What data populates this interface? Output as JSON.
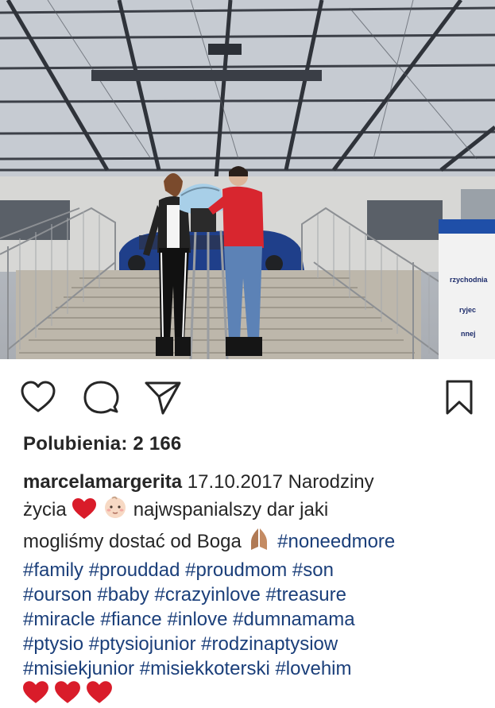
{
  "post": {
    "actions": {
      "like_icon": "heart-outline-icon",
      "comment_icon": "comment-bubble-icon",
      "share_icon": "paper-plane-icon",
      "save_icon": "bookmark-icon"
    },
    "likes_label": "Polubienia:",
    "likes_count": "2 166",
    "caption": {
      "username": "marcelamargerita",
      "date_and_title": "17.10.2017 Narodziny",
      "text_1": "życia",
      "text_2": "najwspanialszy dar jaki",
      "text_3": "mogliśmy dostać od Boga",
      "hashtags": [
        "#noneedmore",
        "#family",
        "#prouddad",
        "#proudmom",
        "#son",
        "#ourson",
        "#baby",
        "#crazyinlove",
        "#treasure",
        "#miracle",
        "#fiance",
        "#inlove",
        "#dumnamama",
        "#ptysio",
        "#ptysiojunior",
        "#rodzinaptysiow",
        "#misiekjunior",
        "#misiekkoterski",
        "#lovehim"
      ],
      "emoji": {
        "heart": "red-heart-emoji",
        "baby": "baby-emoji",
        "pray": "folded-hands-emoji"
      }
    },
    "photo": {
      "sign_lines": [
        "rzychodnia",
        "ryjec",
        "nnej"
      ]
    }
  },
  "colors": {
    "text": "#262626",
    "hashtag": "#1b3f7a",
    "heart": "#d91c2a"
  }
}
